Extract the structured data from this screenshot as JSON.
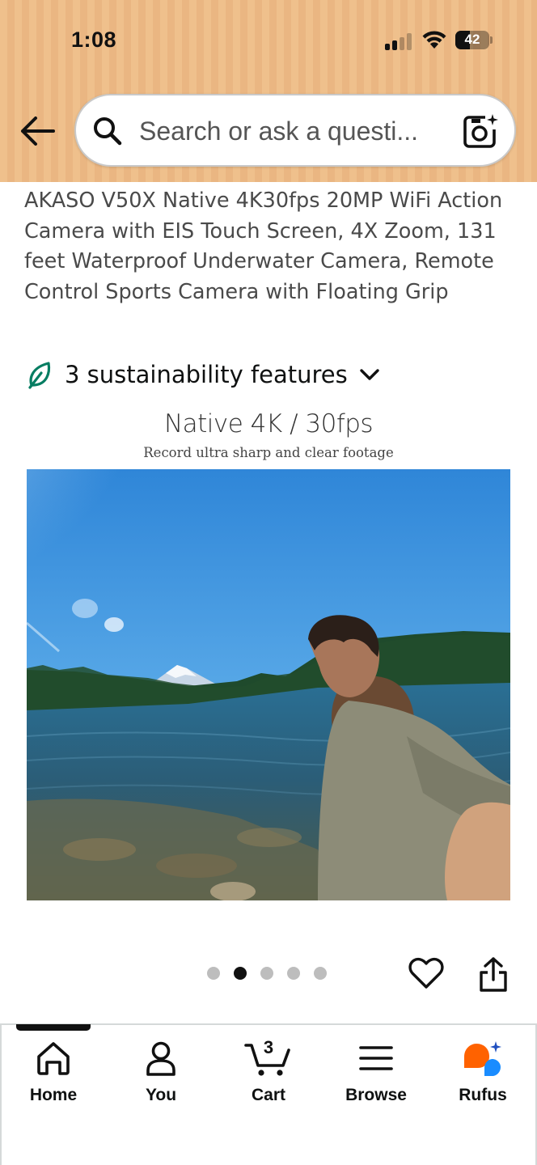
{
  "status_bar": {
    "time": "1:08",
    "battery": "42"
  },
  "header": {
    "search": {
      "placeholder": "Search or ask a questi..."
    }
  },
  "product": {
    "title": "AKASO V50X Native 4K30fps 20MP WiFi Action Camera with EIS Touch Screen, 4X Zoom, 131 feet Waterproof Underwater Camera, Remote Control Sports Camera with Floating Grip",
    "sustainability_label": "3 sustainability features",
    "image": {
      "headline": "Native 4K / 30fps",
      "subline": "Record ultra sharp and clear footage"
    },
    "carousel": {
      "total": 5,
      "active_index": 1
    }
  },
  "bottom_nav": {
    "items": [
      {
        "label": "Home",
        "icon": "home-icon"
      },
      {
        "label": "You",
        "icon": "person-icon"
      },
      {
        "label": "Cart",
        "icon": "cart-icon",
        "badge": "3"
      },
      {
        "label": "Browse",
        "icon": "menu-icon"
      },
      {
        "label": "Rufus",
        "icon": "rufus-icon"
      }
    ],
    "active": "Home"
  },
  "colors": {
    "header_bg": "#eab682",
    "leaf": "#067d62",
    "rufus_orange": "#ff6200",
    "rufus_blue": "#1a8cff"
  }
}
